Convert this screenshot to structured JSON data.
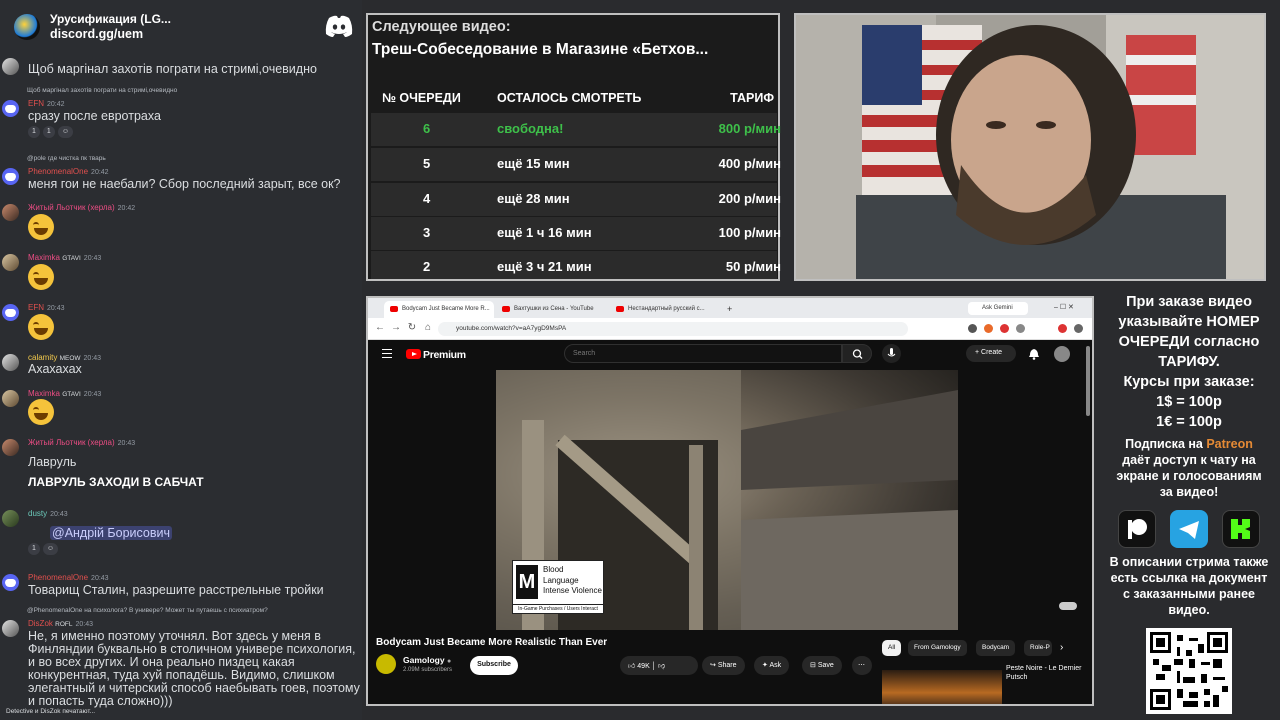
{
  "chat": {
    "server_name": "Урусификация (LG...",
    "invite": "discord.gg/uem",
    "messages": [
      {
        "text": "Щоб маргінал захотів пограти на стримі,очевидно"
      },
      {
        "reply": "Щоб маргінал захотів пограти на стримі,очевидно",
        "name": "EFN",
        "time": "20:42",
        "text": "сразу после евротраха",
        "reactions": [
          "1",
          "1"
        ]
      },
      {
        "reply": "@pole где чистка пк тварь",
        "name": "PhenomenalOne",
        "time": "20:42",
        "text": "меня гои не наебали? Сбор последний зарыт, все ок?"
      },
      {
        "name": "Житый Льотчик (херла)",
        "time": "20:42"
      },
      {
        "name": "Maximka",
        "tag": "GTAVI",
        "time": "20:43"
      },
      {
        "name": "EFN",
        "time": "20:43"
      },
      {
        "name": "calamity",
        "tag": "MEOW",
        "time": "20:43",
        "text": "Ахахахах"
      },
      {
        "name": "Maximka",
        "tag": "GTAVI",
        "time": "20:43"
      },
      {
        "name": "Житый Льотчик (херла)",
        "time": "20:43",
        "text": "Лавруль",
        "text2": "ЛАВРУЛЬ ЗАХОДИ В САБЧАТ"
      },
      {
        "name": "dusty",
        "time": "20:43",
        "text": "@Андрій Борисович",
        "reactions": [
          "1"
        ]
      },
      {
        "name": "PhenomenalOne",
        "time": "20:43",
        "text": "Товарищ Сталин, разрешите расстрельные тройки"
      },
      {
        "reply": "@PhenomenalOne на психолога? В универе? Может ты путаешь с психиатром?",
        "name": "DisZok",
        "tag": "ROFL",
        "time": "20:43",
        "text": "Не, я именно поэтому уточнял. Вот здесь у меня в Финляндии буквально в столичном универе психология, и во всех других. И она реально пиздец какая конкурентная, туда хуй попадёшь. Видимо, слишком элегантный и читерский способ наебывать гоев, поэтому и попасть туда сложно)))"
      }
    ],
    "typing": "Detective и DisZok печатают..."
  },
  "queue": {
    "next_label": "Следующее видео:",
    "next_title": "Треш-Собеседование в Магазине «Бетхов...",
    "headers": {
      "pos": "№ ОЧЕРЕДИ",
      "left": "ОСТАЛОСЬ СМОТРЕТЬ",
      "price": "ТАРИФ"
    },
    "rows": [
      {
        "pos": "6",
        "left": "свободна!",
        "price": "800 р/мин"
      },
      {
        "pos": "5",
        "left": "ещё 15 мин",
        "price": "400 р/мин"
      },
      {
        "pos": "4",
        "left": "ещё 28 мин",
        "price": "200 р/мин"
      },
      {
        "pos": "3",
        "left": "ещё 1 ч 16 мин",
        "price": "100 р/мин"
      },
      {
        "pos": "2",
        "left": "ещё 3 ч 21 мин",
        "price": "50 р/мин"
      }
    ]
  },
  "browser": {
    "tabs": [
      "Bodycam Just Became More R...",
      "Вахтушки из Сена - YouTube",
      "Нестандартный русский с..."
    ],
    "ask_gemini": "Ask Gemini",
    "url": "youtube.com/watch?v=aA7ygD9MsPA",
    "search_placeholder": "Search",
    "logo_text": "Premium",
    "create": "Create",
    "rating": {
      "lines": [
        "Blood",
        "Language",
        "Intense Violence"
      ],
      "footer": "In-Game Purchases / Users Interact",
      "badge": "M"
    },
    "video_title": "Bodycam Just Became More Realistic Than Ever",
    "channel": "Gamology",
    "subscribers": "2.09M subscribers",
    "subscribe": "Subscribe",
    "likes": "49K",
    "share": "Share",
    "ask": "Ask",
    "save": "Save",
    "chips": [
      "All",
      "From Gamology",
      "Bodycam",
      "Role-P"
    ],
    "rec_title": "Peste Noire - Le Dernier Putsch"
  },
  "info": {
    "block1": "При заказе видео\nуказывайте НОМЕР\nОЧЕРЕДИ согласно\nТАРИФУ.",
    "block2": "Курсы при заказе:\n1$ = 100р\n1€ = 100р",
    "sub_prefix": "Подписка на ",
    "patreon": "Patreon",
    "sub_rest": "даёт доступ к чату на\nэкране и голосованиям\nза видео!",
    "block4": "В описании стрима также\nесть ссылка на документ\nс заказанными ранее\nвидео."
  },
  "colors": {
    "patreon": "#e58a35",
    "queue_free": "#3ec04a",
    "discord": "#5865f2"
  }
}
